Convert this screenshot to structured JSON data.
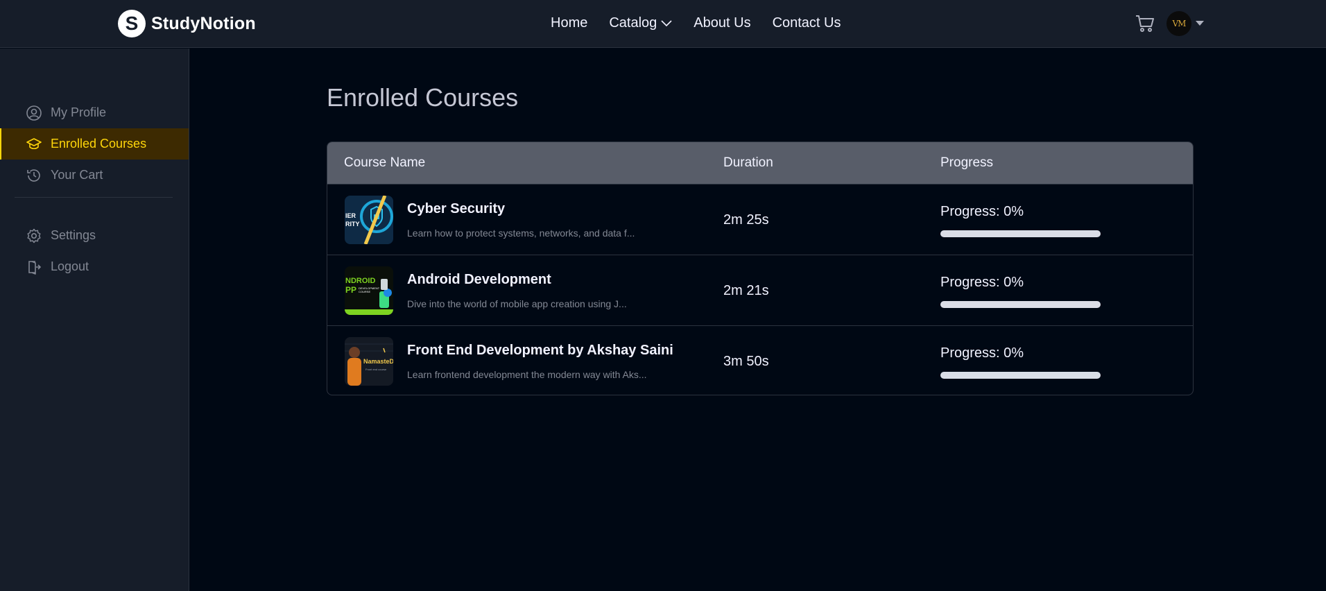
{
  "brand": {
    "name": "StudyNotion",
    "logo_letter": "S"
  },
  "nav": {
    "links": [
      {
        "label": "Home"
      },
      {
        "label": "Catalog"
      },
      {
        "label": "About Us"
      },
      {
        "label": "Contact Us"
      }
    ]
  },
  "user": {
    "initials": "VM"
  },
  "sidebar": {
    "items": [
      {
        "label": "My Profile",
        "icon": "user-circle-icon"
      },
      {
        "label": "Enrolled Courses",
        "icon": "graduation-cap-icon",
        "active": true
      },
      {
        "label": "Your Cart",
        "icon": "history-icon"
      }
    ],
    "bottom_items": [
      {
        "label": "Settings",
        "icon": "gear-icon"
      },
      {
        "label": "Logout",
        "icon": "logout-icon"
      }
    ]
  },
  "main": {
    "title": "Enrolled Courses",
    "table": {
      "headers": [
        "Course Name",
        "Duration",
        "Progress"
      ],
      "rows": [
        {
          "title": "Cyber Security",
          "description": "Learn how to protect systems, networks, and data f...",
          "duration": "2m 25s",
          "progress_label": "Progress: 0%",
          "progress": 0,
          "thumb_text": "IER\nRITY"
        },
        {
          "title": "Android Development",
          "description": "Dive into the world of mobile app creation using J...",
          "duration": "2m 21s",
          "progress_label": "Progress: 0%",
          "progress": 0,
          "thumb_text": "NDROID"
        },
        {
          "title": "Front End Development by Akshay Saini",
          "description": "Learn frontend development the modern way with Aks...",
          "duration": "3m 50s",
          "progress_label": "Progress: 0%",
          "progress": 0,
          "thumb_text": "NamasteD"
        }
      ]
    }
  },
  "colors": {
    "accent": "#ffd60a",
    "active_bg": "#3d2a01",
    "progress_track": "#dbdde6"
  }
}
